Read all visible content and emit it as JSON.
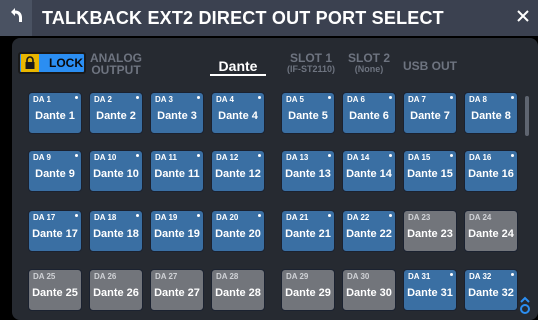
{
  "header": {
    "title": "TALKBACK EXT2 DIRECT OUT PORT SELECT"
  },
  "lock": {
    "label": "LOCK"
  },
  "tabs": [
    {
      "line1": "ANALOG",
      "line2": "OUTPUT",
      "active": false
    },
    {
      "line1": "Dante",
      "line2": "",
      "active": true
    },
    {
      "line1": "SLOT 1",
      "line2": "(IF-ST2110)",
      "active": false
    },
    {
      "line1": "SLOT 2",
      "line2": "(None)",
      "active": false
    },
    {
      "line1": "USB OUT",
      "line2": "",
      "active": false
    }
  ],
  "ports": [
    {
      "tag": "DA 1",
      "name": "Dante 1",
      "selected": true
    },
    {
      "tag": "DA 2",
      "name": "Dante 2",
      "selected": true
    },
    {
      "tag": "DA 3",
      "name": "Dante 3",
      "selected": true
    },
    {
      "tag": "DA 4",
      "name": "Dante 4",
      "selected": true
    },
    {
      "tag": "DA 5",
      "name": "Dante 5",
      "selected": true
    },
    {
      "tag": "DA 6",
      "name": "Dante 6",
      "selected": true
    },
    {
      "tag": "DA 7",
      "name": "Dante 7",
      "selected": true
    },
    {
      "tag": "DA 8",
      "name": "Dante 8",
      "selected": true
    },
    {
      "tag": "DA 9",
      "name": "Dante 9",
      "selected": true
    },
    {
      "tag": "DA 10",
      "name": "Dante 10",
      "selected": true
    },
    {
      "tag": "DA 11",
      "name": "Dante 11",
      "selected": true
    },
    {
      "tag": "DA 12",
      "name": "Dante 12",
      "selected": true
    },
    {
      "tag": "DA 13",
      "name": "Dante 13",
      "selected": true
    },
    {
      "tag": "DA 14",
      "name": "Dante 14",
      "selected": true
    },
    {
      "tag": "DA 15",
      "name": "Dante 15",
      "selected": true
    },
    {
      "tag": "DA 16",
      "name": "Dante 16",
      "selected": true
    },
    {
      "tag": "DA 17",
      "name": "Dante 17",
      "selected": true
    },
    {
      "tag": "DA 18",
      "name": "Dante 18",
      "selected": true
    },
    {
      "tag": "DA 19",
      "name": "Dante 19",
      "selected": true
    },
    {
      "tag": "DA 20",
      "name": "Dante 20",
      "selected": true
    },
    {
      "tag": "DA 21",
      "name": "Dante 21",
      "selected": true
    },
    {
      "tag": "DA 22",
      "name": "Dante 22",
      "selected": true
    },
    {
      "tag": "DA 23",
      "name": "Dante 23",
      "selected": false
    },
    {
      "tag": "DA 24",
      "name": "Dante 24",
      "selected": false
    },
    {
      "tag": "DA 25",
      "name": "Dante 25",
      "selected": false
    },
    {
      "tag": "DA 26",
      "name": "Dante 26",
      "selected": false
    },
    {
      "tag": "DA 27",
      "name": "Dante 27",
      "selected": false
    },
    {
      "tag": "DA 28",
      "name": "Dante 28",
      "selected": false
    },
    {
      "tag": "DA 29",
      "name": "Dante 29",
      "selected": false
    },
    {
      "tag": "DA 30",
      "name": "Dante 30",
      "selected": false
    },
    {
      "tag": "DA 31",
      "name": "Dante 31",
      "selected": true
    },
    {
      "tag": "DA 32",
      "name": "Dante 32",
      "selected": true
    }
  ],
  "colors": {
    "selected": "#3a6fa3",
    "unselected": "#72757b",
    "lock_on": "#2b8ef2",
    "lock_icon": "#e8b600",
    "scroll_hint": "#2b8ef2"
  }
}
